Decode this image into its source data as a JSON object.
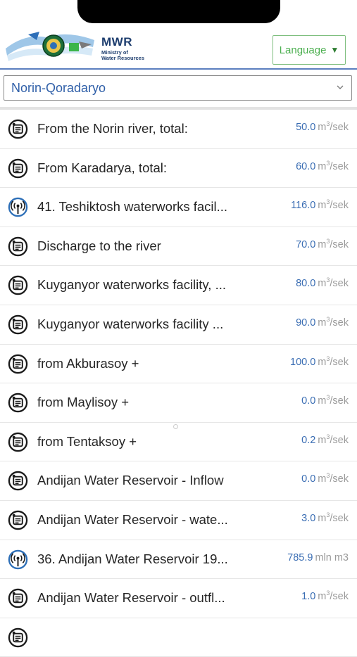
{
  "header": {
    "org_short": "MWR",
    "org_full": "Ministry of\nWater Resources",
    "language_label": "Language",
    "language_arrow": "▼"
  },
  "selector": {
    "selected": "Norin-Qoradaryo"
  },
  "rows": [
    {
      "label": "From the Norin river, total:",
      "value": "50.0",
      "unit": "m",
      "unit_sup": "3",
      "unit_tail": "/sek",
      "icon": "water-meter-icon"
    },
    {
      "label": "From Karadarya, total:",
      "value": "60.0",
      "unit": "m",
      "unit_sup": "3",
      "unit_tail": "/sek",
      "icon": "water-meter-icon"
    },
    {
      "label": "41. Teshiktosh waterworks facil...",
      "value": "116.0",
      "unit": "m",
      "unit_sup": "3",
      "unit_tail": "/sek",
      "icon": "broadcast-sensor-icon"
    },
    {
      "label": "Discharge to the river",
      "value": "70.0",
      "unit": "m",
      "unit_sup": "3",
      "unit_tail": "/sek",
      "icon": "water-meter-icon"
    },
    {
      "label": "Kuyganyor waterworks facility, ...",
      "value": "80.0",
      "unit": "m",
      "unit_sup": "3",
      "unit_tail": "/sek",
      "icon": "water-meter-icon"
    },
    {
      "label": "Kuyganyor waterworks facility ...",
      "value": "90.0",
      "unit": "m",
      "unit_sup": "3",
      "unit_tail": "/sek",
      "icon": "water-meter-icon"
    },
    {
      "label": "from Akburasoy +",
      "value": "100.0",
      "unit": "m",
      "unit_sup": "3",
      "unit_tail": "/sek",
      "icon": "water-meter-icon"
    },
    {
      "label": "from Maylisoy +",
      "value": "0.0",
      "unit": "m",
      "unit_sup": "3",
      "unit_tail": "/sek",
      "icon": "water-meter-icon"
    },
    {
      "label": "from Tentaksoy +",
      "value": "0.2",
      "unit": "m",
      "unit_sup": "3",
      "unit_tail": "/sek",
      "icon": "water-meter-icon"
    },
    {
      "label": "Andijan Water Reservoir - Inflow",
      "value": "0.0",
      "unit": "m",
      "unit_sup": "3",
      "unit_tail": "/sek",
      "icon": "water-meter-icon"
    },
    {
      "label": "Andijan Water Reservoir - wate...",
      "value": "3.0",
      "unit": "m",
      "unit_sup": "3",
      "unit_tail": "/sek",
      "icon": "water-meter-icon"
    },
    {
      "label": "36. Andijan Water Reservoir 19...",
      "value": "785.9",
      "unit": "mln m3",
      "unit_sup": "",
      "unit_tail": "",
      "icon": "broadcast-sensor-icon"
    },
    {
      "label": "Andijan Water Reservoir - outfl...",
      "value": "1.0",
      "unit": "m",
      "unit_sup": "3",
      "unit_tail": "/sek",
      "icon": "water-meter-icon"
    },
    {
      "label": "",
      "value": "",
      "unit": "",
      "unit_sup": "",
      "unit_tail": "",
      "icon": "water-meter-icon"
    }
  ]
}
